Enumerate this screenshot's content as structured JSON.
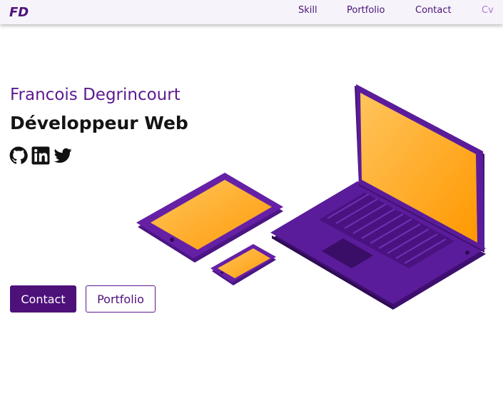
{
  "nav": {
    "logo_text": "FD",
    "links": [
      {
        "label": "Skill"
      },
      {
        "label": "Portfolio"
      },
      {
        "label": "Contact"
      },
      {
        "label": "Cv"
      }
    ]
  },
  "hero": {
    "name": "Francois Degrincourt",
    "role": "Développeur Web",
    "social_icons": [
      "github-icon",
      "linkedin-icon",
      "twitter-icon"
    ]
  },
  "actions": {
    "contact_label": "Contact",
    "portfolio_label": "Portfolio"
  },
  "colors": {
    "accent": "#4e117a",
    "name_purple": "#5d1a8f",
    "cv_link": "#b07ad6",
    "device_body": "#4b1583",
    "screen": "#ffa51f"
  }
}
